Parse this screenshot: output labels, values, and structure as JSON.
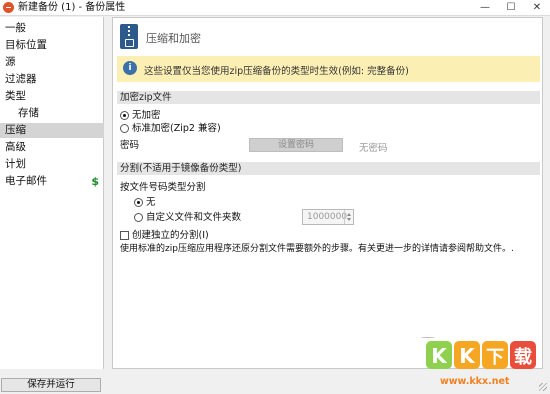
{
  "window": {
    "title": "新建备份 (1) - 备份属性",
    "controls": [
      "—",
      "☐",
      "✕"
    ]
  },
  "sidebar": {
    "items": [
      {
        "label": "一般"
      },
      {
        "label": "目标位置"
      },
      {
        "label": "源"
      },
      {
        "label": "过滤器"
      },
      {
        "label": "类型"
      },
      {
        "label": "存储"
      },
      {
        "label": "压缩",
        "selected": true
      },
      {
        "label": "高级"
      },
      {
        "label": "计划"
      },
      {
        "label": "电子邮件",
        "badge": "$"
      }
    ],
    "save_run_label": "保存并运行"
  },
  "header": {
    "title": "压缩和加密",
    "icon": "zip-archive-icon"
  },
  "notice": {
    "icon": "info-icon",
    "text": "这些设置仅当您使用zip压缩备份的类型时生效(例如: 完整备份)"
  },
  "encrypt": {
    "section_title": "加密zip文件",
    "option_none": "无加密",
    "option_standard": "标准加密(Zip2 兼容)",
    "selected": "none",
    "password_label": "密码",
    "set_password_button": "设置密码",
    "no_password_text": "无密码"
  },
  "split": {
    "section_title": "分割(不适用于镜像备份类型)",
    "by_type_label": "按文件号码类型分割",
    "option_none": "无",
    "option_custom": "自定义文件和文件夹数",
    "selected": "none",
    "custom_value": "1000000",
    "create_split_label": "创建独立的分割(I)",
    "create_split_checked": false,
    "help_text": "使用标准的zip压缩应用程序还原分割文件需要额外的步骤。有关更进一步的详情请参阅帮助文件。."
  },
  "watermark": {
    "url": "www.kkx.net"
  },
  "colors": {
    "selected_nav": "#d4d4d4",
    "notice_bg": "#fcefb4",
    "badge_green": "#1a8a2a",
    "watermark_orange": "#f08020"
  }
}
